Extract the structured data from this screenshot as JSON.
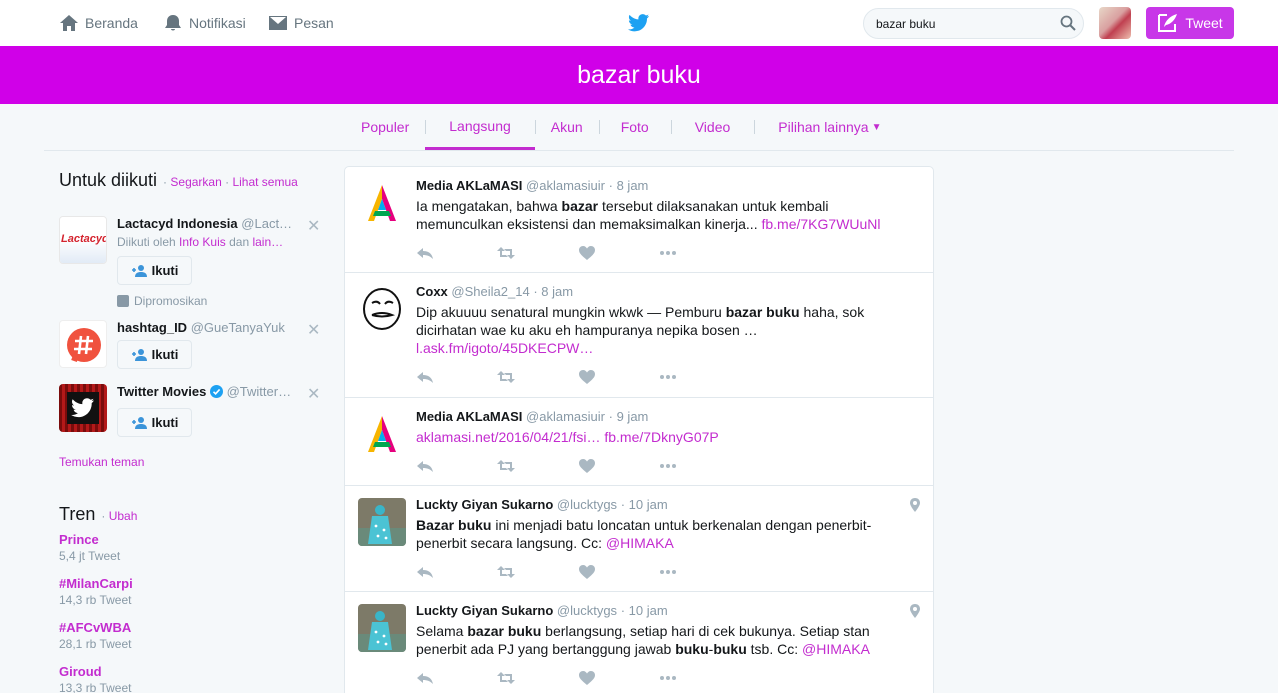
{
  "nav": {
    "home": "Beranda",
    "notifications": "Notifikasi",
    "messages": "Pesan",
    "search_value": "bazar buku",
    "tweet_button": "Tweet"
  },
  "search_header": {
    "query": "bazar buku"
  },
  "tabs": [
    {
      "label": "Populer"
    },
    {
      "label": "Langsung",
      "active": true
    },
    {
      "label": "Akun"
    },
    {
      "label": "Foto"
    },
    {
      "label": "Video"
    },
    {
      "label": "Pilihan lainnya"
    }
  ],
  "who_to_follow": {
    "title": "Untuk diikuti",
    "refresh": "Segarkan",
    "separator": "·",
    "view_all": "Lihat semua",
    "accounts": [
      {
        "name": "Lactacyd Indonesia",
        "handle": "@Lact…",
        "context_prefix": "Diikuti oleh",
        "context_user": "Info Kuis",
        "context_mid": "dan",
        "context_more": "lain…",
        "follow": "Ikuti",
        "promoted": "Dipromosikan",
        "logo_text": "Lactacyd"
      },
      {
        "name": "hashtag_ID",
        "handle": "@GueTanyaYuk",
        "follow": "Ikuti"
      },
      {
        "name": "Twitter Movies",
        "handle": "@Twitter…",
        "follow": "Ikuti"
      }
    ],
    "find_friends": "Temukan teman"
  },
  "trends": {
    "title": "Tren",
    "change": "Ubah",
    "items": [
      {
        "name": "Prince",
        "count": "5,4 jt Tweet"
      },
      {
        "name": "#MilanCarpi",
        "count": "14,3 rb Tweet"
      },
      {
        "name": "#AFCvWBA",
        "count": "28,1 rb Tweet"
      },
      {
        "name": "Giroud",
        "count": "13,3 rb Tweet"
      }
    ]
  },
  "tweets": [
    {
      "name": "Media AKLaMASI",
      "handle": "@aklamasiuir",
      "sep": "·",
      "time": "8 jam",
      "t1": "Ia mengatakan, bahwa ",
      "b1": "bazar",
      "t2": " tersebut dilaksanakan untuk kembali memunculkan eksistensi dan memaksimalkan kinerja... ",
      "link1": "fb.me/7KG7WUuNl"
    },
    {
      "name": "Coxx",
      "handle": "@Sheila2_14",
      "sep": "·",
      "time": "8 jam",
      "t1": "Dip akuuuu senatural mungkin wkwk — Pemburu ",
      "b1": "bazar buku",
      "t2": " haha, sok dicirhatan wae ku aku eh hampuranya nepika bosen … ",
      "link1": "l.ask.fm/igoto/45DKECPW…"
    },
    {
      "name": "Media AKLaMASI",
      "handle": "@aklamasiuir",
      "sep": "·",
      "time": "9 jam",
      "link1": "aklamasi.net/2016/04/21/fsi…",
      "link2": "fb.me/7DknyG07P"
    },
    {
      "name": "Luckty Giyan Sukarno",
      "handle": "@lucktygs",
      "sep": "·",
      "time": "10 jam",
      "b1": "Bazar buku",
      "t1": " ini menjadi batu loncatan untuk berkenalan dengan penerbit-penerbit secara langsung. Cc: ",
      "mention": "@HIMAKA"
    },
    {
      "name": "Luckty Giyan Sukarno",
      "handle": "@lucktygs",
      "sep": "·",
      "time": "10 jam",
      "t1": "Selama ",
      "b1": "bazar buku",
      "t2": " berlangsung, setiap hari di cek bukunya. Setiap stan penerbit ada PJ yang bertanggung jawab ",
      "b2": "buku",
      "t3": "-",
      "b3": "buku",
      "t4": " tsb. Cc: ",
      "mention": "@HIMAKA"
    }
  ],
  "colors": {
    "accent": "#c32ccf",
    "header_bg": "#d000e8",
    "tweet_button": "#c837e8"
  },
  "icons": [
    "home-icon",
    "notifications-icon",
    "messages-icon",
    "twitter-bird-icon",
    "search-icon",
    "compose-icon",
    "add-user-icon",
    "close-icon",
    "reply-icon",
    "retweet-icon",
    "like-icon",
    "more-icon",
    "location-icon",
    "verified-icon",
    "promoted-icon"
  ]
}
